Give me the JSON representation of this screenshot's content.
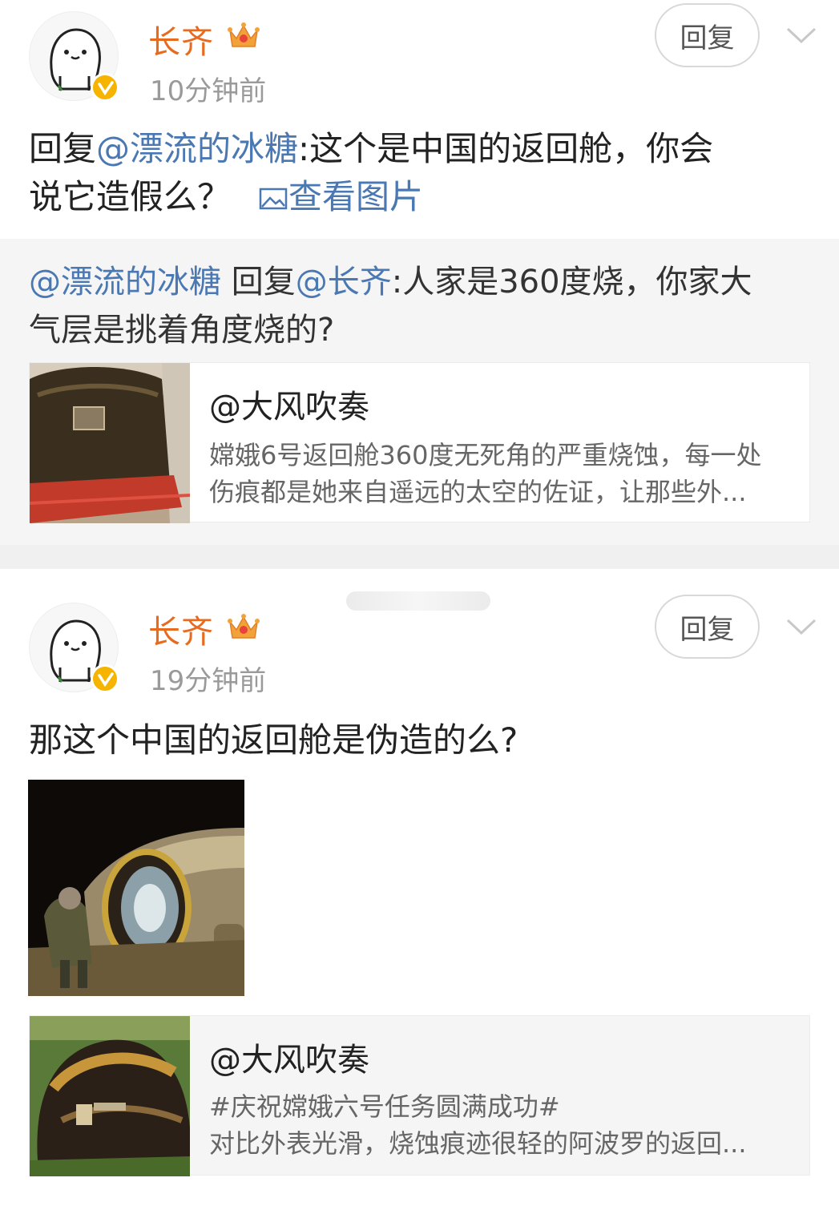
{
  "comments": [
    {
      "username": "长齐",
      "time": "10分钟前",
      "reply_label": "回复",
      "text_prefix": "回复",
      "mention": "@漂流的冰糖",
      "text_line1_rest": ":这个是中国的返回舱，你会",
      "text_line2": "说它造假么？",
      "view_image_label": "查看图片",
      "quote": {
        "mention1": "@漂流的冰糖",
        "reply_word": " 回复",
        "mention2": "@长齐",
        "text_line1_rest": ":人家是360度烧，你家大",
        "text_line2": "气层是挑着角度烧的?",
        "card": {
          "title": "@大风吹奏",
          "desc_line1": "嫦娥6号返回舱360度无死角的严重烧蚀，每一处",
          "desc_line2": "伤痕都是她来自遥远的太空的佐证，让那些外..."
        }
      }
    },
    {
      "username": "长齐",
      "time": "19分钟前",
      "reply_label": "回复",
      "text": "那这个中国的返回舱是伪造的么?",
      "card": {
        "title": "@大风吹奏",
        "desc_line1": "#庆祝嫦娥六号任务圆满成功#",
        "desc_line2": "对比外表光滑，烧蚀痕迹很轻的阿波罗的返回..."
      }
    }
  ],
  "colors": {
    "username": "#e86a1d",
    "mention": "#4a78b3",
    "badge": "#f6b400"
  },
  "icons": [
    "avatar-cartoon",
    "crown-icon",
    "verified-badge-icon",
    "chevron-down-icon",
    "image-icon"
  ]
}
